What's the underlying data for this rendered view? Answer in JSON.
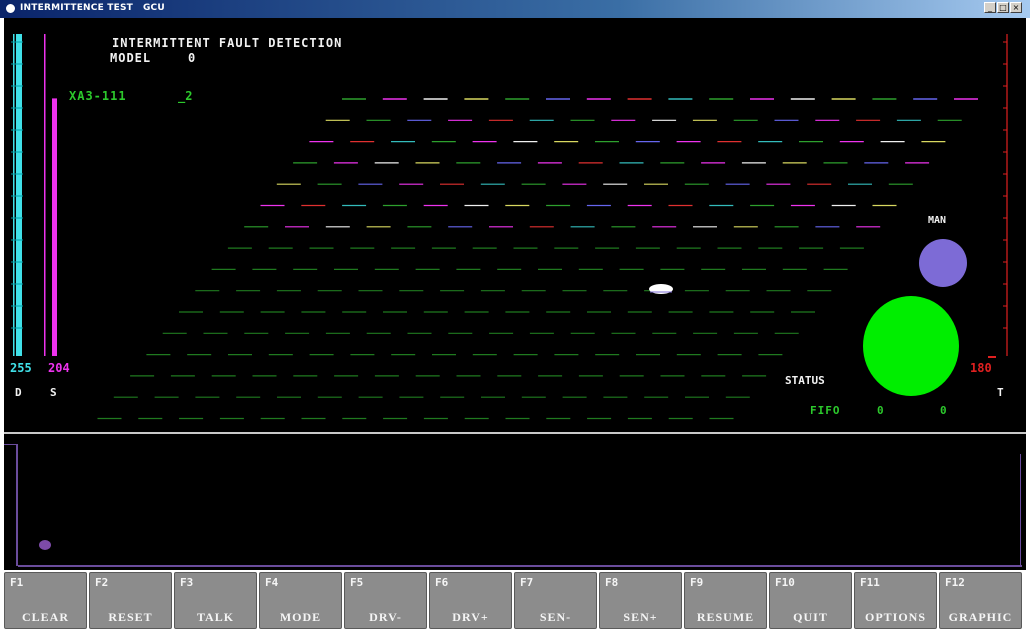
{
  "window": {
    "title": "INTERMITTENCE TEST   GCU",
    "controls": {
      "minimize": "_",
      "maximize": "□",
      "close": "×"
    }
  },
  "display": {
    "heading": "INTERMITTENT FAULT DETECTION",
    "model_label": "MODEL",
    "model_value": "0",
    "channel_id": "XA3-111",
    "channel_suffix": "_2",
    "status_label": "STATUS",
    "man_label": "MAN",
    "fifo_label": "FIFO",
    "fifo_value_a": "0",
    "fifo_value_b": "0",
    "gauges": {
      "d": {
        "label": "D",
        "value": "255",
        "level": 255,
        "max": 255
      },
      "s": {
        "label": "S",
        "value": "204",
        "level": 204,
        "max": 255
      },
      "t": {
        "label": "T",
        "value": "180",
        "level": 0,
        "max": 255
      }
    },
    "indicators": {
      "man_color": "#7d6bd6",
      "status_color": "#00ee00"
    }
  },
  "colors": {
    "background": "#000000",
    "grid_default": "#1f7a1f",
    "grid_accents": [
      "#2da02d",
      "#ee33ee",
      "#f0f0f0",
      "#d8d860",
      "#6666ee",
      "#e03030",
      "#33bbbb"
    ],
    "d_gauge": "#40e0e8",
    "s_gauge": "#ee33ee",
    "t_gauge": "#e02020"
  },
  "function_keys": [
    {
      "key": "F1",
      "label": "CLEAR"
    },
    {
      "key": "F2",
      "label": "RESET"
    },
    {
      "key": "F3",
      "label": "TALK"
    },
    {
      "key": "F4",
      "label": "MODE"
    },
    {
      "key": "F5",
      "label": "DRV-"
    },
    {
      "key": "F6",
      "label": "DRV+"
    },
    {
      "key": "F7",
      "label": "SEN-"
    },
    {
      "key": "F8",
      "label": "SEN+"
    },
    {
      "key": "F9",
      "label": "RESUME"
    },
    {
      "key": "F10",
      "label": "QUIT"
    },
    {
      "key": "F11",
      "label": "OPTIONS"
    },
    {
      "key": "F12",
      "label": "GRAPHIC"
    }
  ]
}
